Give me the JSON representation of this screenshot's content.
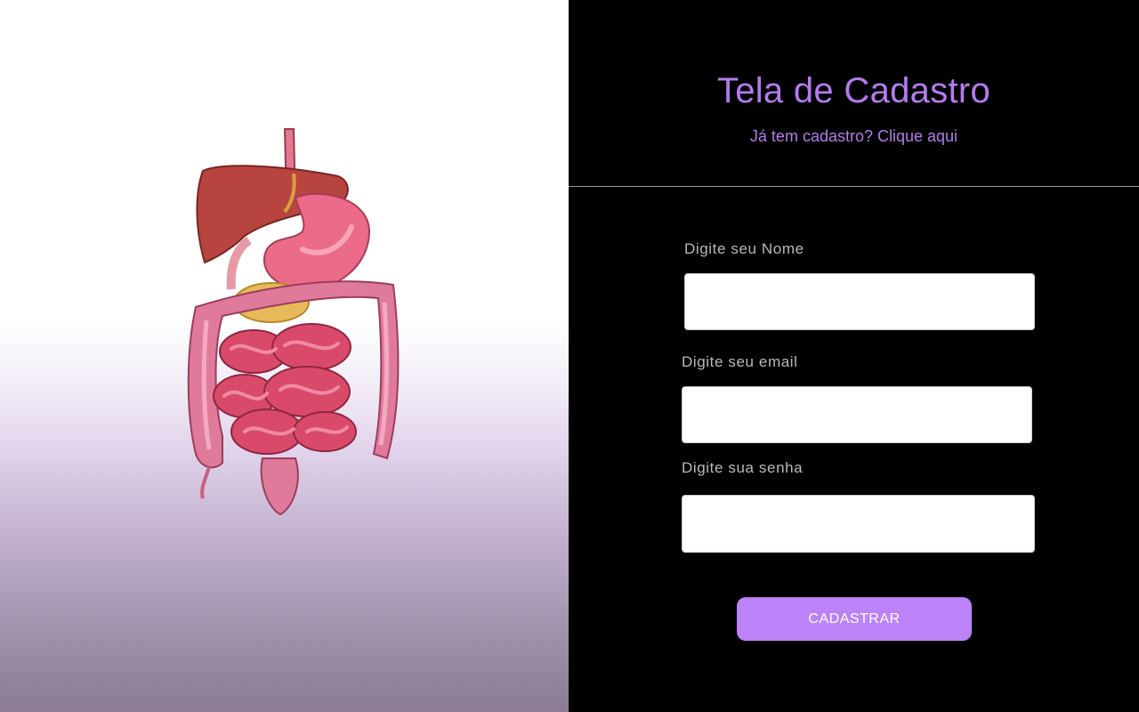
{
  "illustration": {
    "icon": "digestive-system-illustration"
  },
  "form": {
    "title": "Tela de Cadastro",
    "login_link": "Já tem cadastro? Clique aqui",
    "name_label": "Digite seu Nome",
    "name_value": "",
    "email_label": "Digite seu email",
    "email_value": "",
    "password_label": "Digite sua senha",
    "password_value": "",
    "submit_label": "CADASTRAR"
  },
  "colors": {
    "accent": "#bc82f7",
    "title": "#b57bee",
    "background_right": "#000000",
    "label": "#b9b9b9"
  }
}
